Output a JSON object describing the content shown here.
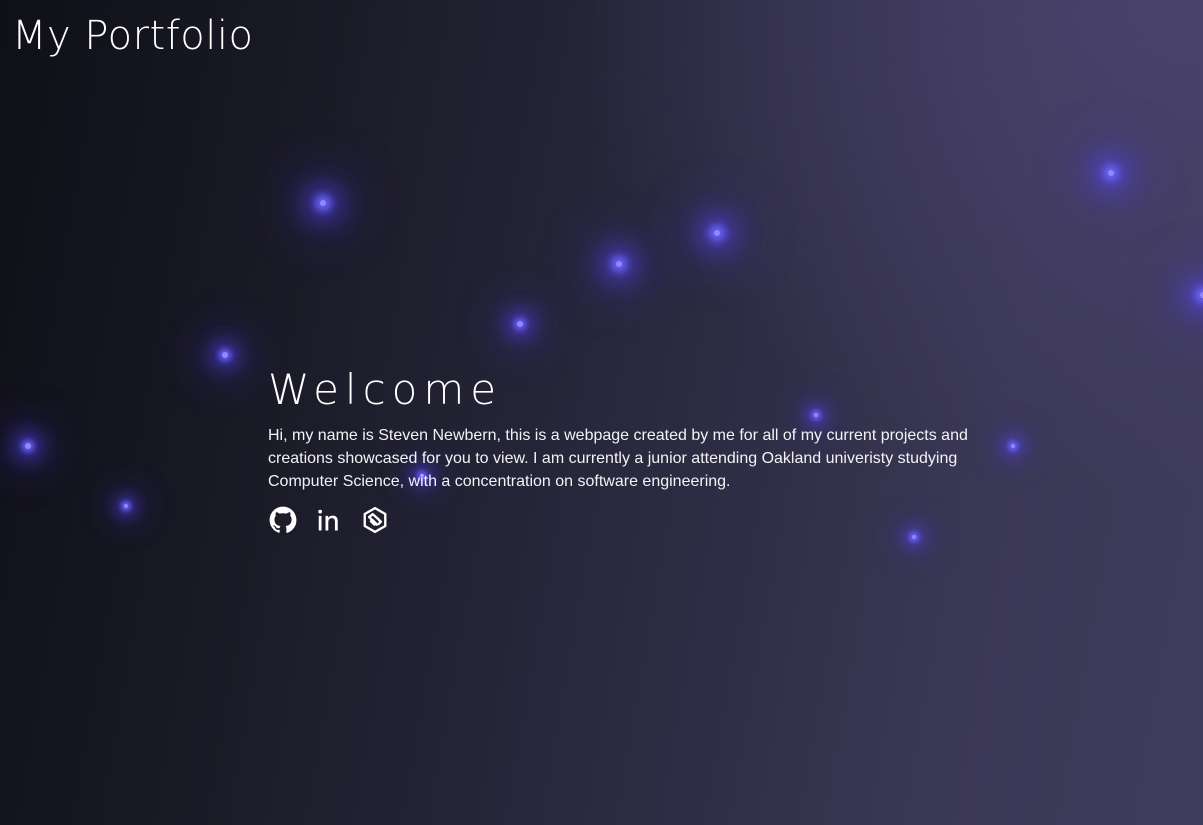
{
  "header": {
    "title": "My Portfolio"
  },
  "hero": {
    "title": "Welcome",
    "text": "Hi, my name is Steven Newbern, this is a webpage created by me for all of my current projects and creations showcased for you to view. I am currently a junior attending Oakland univeristy studying Computer Science, with a concentration on software engineering."
  },
  "social": [
    {
      "icon": "github-icon"
    },
    {
      "icon": "linkedin-icon"
    },
    {
      "icon": "handshake-icon"
    }
  ],
  "colors": {
    "background_dark": "#0f0f17",
    "background_light": "#403c5c",
    "glow": "#6f63ff",
    "text": "#ffffff"
  }
}
